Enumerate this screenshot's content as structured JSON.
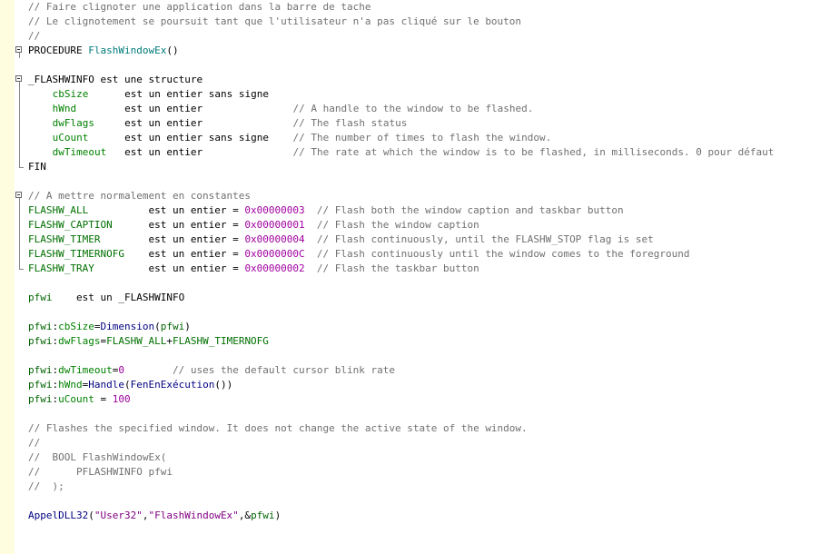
{
  "editor": {
    "lines": [
      {
        "fold": null,
        "indent": 0,
        "tokens": [
          {
            "t": "// Faire clignoter une application dans la barre de tache",
            "c": "comment"
          }
        ]
      },
      {
        "fold": null,
        "indent": 0,
        "tokens": [
          {
            "t": "// Le clignotement se poursuit tant que l'utilisateur n'a pas cliqué sur le bouton",
            "c": "comment"
          }
        ]
      },
      {
        "fold": null,
        "indent": 0,
        "tokens": [
          {
            "t": "//",
            "c": "comment"
          }
        ]
      },
      {
        "fold": "box",
        "indent": 0,
        "tokens": [
          {
            "t": "PROCEDURE ",
            "c": "kw"
          },
          {
            "t": "FlashWindowEx",
            "c": "proc"
          },
          {
            "t": "()",
            "c": "op"
          }
        ]
      },
      {
        "fold": null,
        "indent": 0,
        "tokens": []
      },
      {
        "fold": "box",
        "indent": 0,
        "tokens": [
          {
            "t": "_FLASHWINFO",
            "c": "struct"
          },
          {
            "t": " est une structure",
            "c": "type"
          }
        ]
      },
      {
        "fold": "line",
        "indent": 4,
        "tokens": [
          {
            "t": "cbSize",
            "c": "member"
          },
          {
            "t": "      est un entier sans signe",
            "c": "type"
          }
        ]
      },
      {
        "fold": "line",
        "indent": 4,
        "tokens": [
          {
            "t": "hWnd",
            "c": "member"
          },
          {
            "t": "        est un entier               ",
            "c": "type"
          },
          {
            "t": "// A handle to the window to be flashed.",
            "c": "comment"
          }
        ]
      },
      {
        "fold": "line",
        "indent": 4,
        "tokens": [
          {
            "t": "dwFlags",
            "c": "member"
          },
          {
            "t": "     est un entier               ",
            "c": "type"
          },
          {
            "t": "// The flash status",
            "c": "comment"
          }
        ]
      },
      {
        "fold": "line",
        "indent": 4,
        "tokens": [
          {
            "t": "uCount",
            "c": "member"
          },
          {
            "t": "      est un entier sans signe    ",
            "c": "type"
          },
          {
            "t": "// The number of times to flash the window.",
            "c": "comment"
          }
        ]
      },
      {
        "fold": "line",
        "indent": 4,
        "tokens": [
          {
            "t": "dwTimeout",
            "c": "member"
          },
          {
            "t": "   est un entier               ",
            "c": "type"
          },
          {
            "t": "// The rate at which the window is to be flashed, in milliseconds. 0 pour défaut",
            "c": "comment"
          }
        ]
      },
      {
        "fold": "end",
        "indent": 0,
        "tokens": [
          {
            "t": "FIN",
            "c": "kw"
          }
        ]
      },
      {
        "fold": null,
        "indent": 0,
        "tokens": []
      },
      {
        "fold": "box",
        "indent": 0,
        "tokens": [
          {
            "t": "// A mettre normalement en constantes",
            "c": "comment"
          }
        ]
      },
      {
        "fold": "line",
        "indent": 0,
        "tokens": [
          {
            "t": "FLASHW_ALL",
            "c": "const"
          },
          {
            "t": "          est un entier = ",
            "c": "type"
          },
          {
            "t": "0x00000003",
            "c": "num"
          },
          {
            "t": "  // Flash both the window caption and taskbar button",
            "c": "comment"
          }
        ]
      },
      {
        "fold": "line",
        "indent": 0,
        "tokens": [
          {
            "t": "FLASHW_CAPTION",
            "c": "const"
          },
          {
            "t": "      est un entier = ",
            "c": "type"
          },
          {
            "t": "0x00000001",
            "c": "num"
          },
          {
            "t": "  // Flash the window caption",
            "c": "comment"
          }
        ]
      },
      {
        "fold": "line",
        "indent": 0,
        "tokens": [
          {
            "t": "FLASHW_TIMER",
            "c": "const"
          },
          {
            "t": "        est un entier = ",
            "c": "type"
          },
          {
            "t": "0x00000004",
            "c": "num"
          },
          {
            "t": "  // Flash continuously, until the FLASHW_STOP flag is set",
            "c": "comment"
          }
        ]
      },
      {
        "fold": "line",
        "indent": 0,
        "tokens": [
          {
            "t": "FLASHW_TIMERNOFG",
            "c": "const"
          },
          {
            "t": "    est un entier = ",
            "c": "type"
          },
          {
            "t": "0x0000000C",
            "c": "num"
          },
          {
            "t": "  // Flash continuously until the window comes to the foreground",
            "c": "comment"
          }
        ]
      },
      {
        "fold": "end",
        "indent": 0,
        "tokens": [
          {
            "t": "FLASHW_TRAY",
            "c": "const"
          },
          {
            "t": "         est un entier = ",
            "c": "type"
          },
          {
            "t": "0x00000002",
            "c": "num"
          },
          {
            "t": "  // Flash the taskbar button",
            "c": "comment"
          }
        ]
      },
      {
        "fold": null,
        "indent": 0,
        "tokens": []
      },
      {
        "fold": null,
        "indent": 0,
        "tokens": [
          {
            "t": "pfwi",
            "c": "var"
          },
          {
            "t": "    est un _FLASHWINFO",
            "c": "type"
          }
        ]
      },
      {
        "fold": null,
        "indent": 0,
        "tokens": []
      },
      {
        "fold": null,
        "indent": 0,
        "tokens": [
          {
            "t": "pfwi",
            "c": "var"
          },
          {
            "t": ":",
            "c": "op"
          },
          {
            "t": "cbSize",
            "c": "member"
          },
          {
            "t": "=",
            "c": "op"
          },
          {
            "t": "Dimension",
            "c": "func"
          },
          {
            "t": "(",
            "c": "op"
          },
          {
            "t": "pfwi",
            "c": "var"
          },
          {
            "t": ")",
            "c": "op"
          }
        ]
      },
      {
        "fold": null,
        "indent": 0,
        "tokens": [
          {
            "t": "pfwi",
            "c": "var"
          },
          {
            "t": ":",
            "c": "op"
          },
          {
            "t": "dwFlags",
            "c": "member"
          },
          {
            "t": "=",
            "c": "op"
          },
          {
            "t": "FLASHW_ALL",
            "c": "const"
          },
          {
            "t": "+",
            "c": "op"
          },
          {
            "t": "FLASHW_TIMERNOFG",
            "c": "const"
          }
        ]
      },
      {
        "fold": null,
        "indent": 0,
        "tokens": []
      },
      {
        "fold": null,
        "indent": 0,
        "tokens": [
          {
            "t": "pfwi",
            "c": "var"
          },
          {
            "t": ":",
            "c": "op"
          },
          {
            "t": "dwTimeout",
            "c": "member"
          },
          {
            "t": "=",
            "c": "op"
          },
          {
            "t": "0",
            "c": "num"
          },
          {
            "t": "        // uses the default cursor blink rate",
            "c": "comment"
          }
        ]
      },
      {
        "fold": null,
        "indent": 0,
        "tokens": [
          {
            "t": "pfwi",
            "c": "var"
          },
          {
            "t": ":",
            "c": "op"
          },
          {
            "t": "hWnd",
            "c": "member"
          },
          {
            "t": "=",
            "c": "op"
          },
          {
            "t": "Handle",
            "c": "func"
          },
          {
            "t": "(",
            "c": "op"
          },
          {
            "t": "FenEnExécution",
            "c": "func"
          },
          {
            "t": "())",
            "c": "op"
          }
        ]
      },
      {
        "fold": null,
        "indent": 0,
        "tokens": [
          {
            "t": "pfwi",
            "c": "var"
          },
          {
            "t": ":",
            "c": "op"
          },
          {
            "t": "uCount",
            "c": "member"
          },
          {
            "t": " = ",
            "c": "op"
          },
          {
            "t": "100",
            "c": "num"
          }
        ]
      },
      {
        "fold": null,
        "indent": 0,
        "tokens": []
      },
      {
        "fold": null,
        "indent": 0,
        "tokens": [
          {
            "t": "// Flashes the specified window. It does not change the active state of the window.",
            "c": "comment"
          }
        ]
      },
      {
        "fold": null,
        "indent": 0,
        "tokens": [
          {
            "t": "//",
            "c": "comment"
          }
        ]
      },
      {
        "fold": null,
        "indent": 0,
        "tokens": [
          {
            "t": "//  BOOL FlashWindowEx(",
            "c": "comment"
          }
        ]
      },
      {
        "fold": null,
        "indent": 0,
        "tokens": [
          {
            "t": "//      PFLASHWINFO pfwi",
            "c": "comment"
          }
        ]
      },
      {
        "fold": null,
        "indent": 0,
        "tokens": [
          {
            "t": "//  );",
            "c": "comment"
          }
        ]
      },
      {
        "fold": null,
        "indent": 0,
        "tokens": []
      },
      {
        "fold": null,
        "indent": 0,
        "tokens": [
          {
            "t": "AppelDLL32",
            "c": "func"
          },
          {
            "t": "(",
            "c": "op"
          },
          {
            "t": "\"User32\"",
            "c": "str"
          },
          {
            "t": ",",
            "c": "op"
          },
          {
            "t": "\"FlashWindowEx\"",
            "c": "str"
          },
          {
            "t": ",&",
            "c": "op"
          },
          {
            "t": "pfwi",
            "c": "var"
          },
          {
            "t": ")",
            "c": "op"
          }
        ]
      }
    ]
  }
}
